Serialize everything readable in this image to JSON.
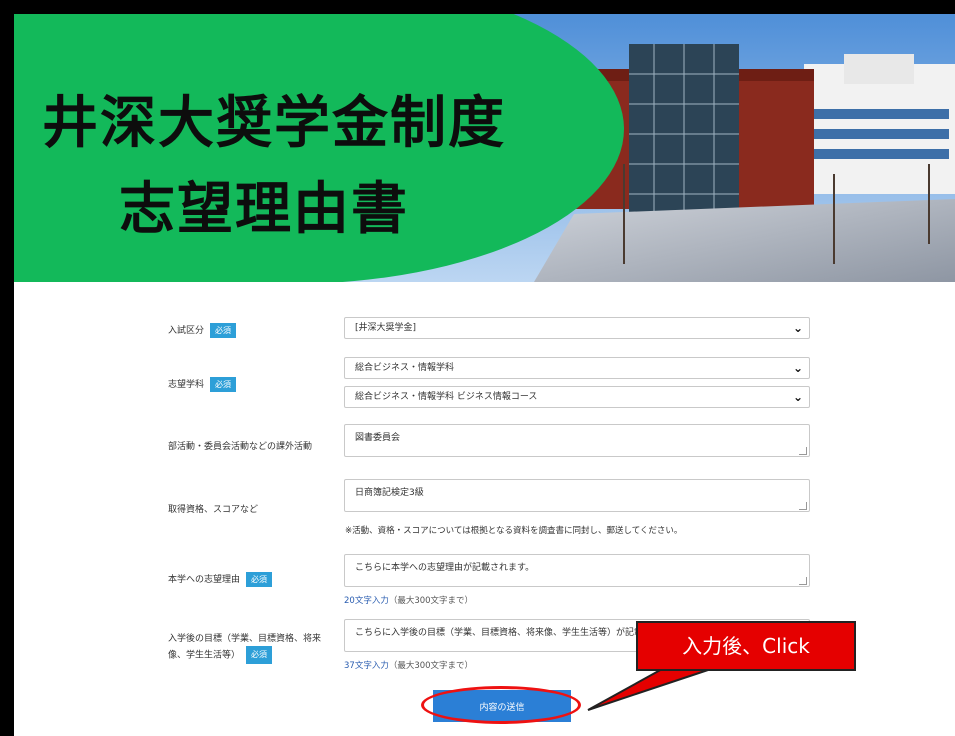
{
  "banner": {
    "title_line1": "井深大奨学金制度",
    "title_line2": "志望理由書"
  },
  "form": {
    "required_badge": "必須",
    "exam_category": {
      "label": "入試区分",
      "value": "[井深大奨学金]"
    },
    "desired_department": {
      "label": "志望学科",
      "value1": "総合ビジネス・情報学科",
      "value2": "総合ビジネス・情報学科 ビジネス情報コース"
    },
    "extracurricular": {
      "label": "部活動・委員会活動などの課外活動",
      "value": "図書委員会"
    },
    "qualifications": {
      "label": "取得資格、スコアなど",
      "value": "日商簿記検定3級",
      "note": "※活動、資格・スコアについては根拠となる資料を調査書に同封し、郵送してください。"
    },
    "motivation": {
      "label": "本学への志望理由",
      "value": "こちらに本学への志望理由が記載されます。",
      "count_num": "20文字入力",
      "count_max": "（最大300文字まで）"
    },
    "goals": {
      "label_line1": "入学後の目標（学業、目標資格、将来",
      "label_line2": "像、学生生活等）",
      "value": "こちらに入学後の目標（学業、目標資格、将来像、学生生活等）が記載されます。",
      "count_num": "37文字入力",
      "count_max": "（最大300文字まで）"
    },
    "submit_label": "内容の送信"
  },
  "annotation": {
    "callout_text": "入力後、Click",
    "callout_color": "#e50000"
  },
  "colors": {
    "banner_green": "#13b95a",
    "badge_blue": "#2d9fd8",
    "submit_blue": "#2b7fd6"
  }
}
